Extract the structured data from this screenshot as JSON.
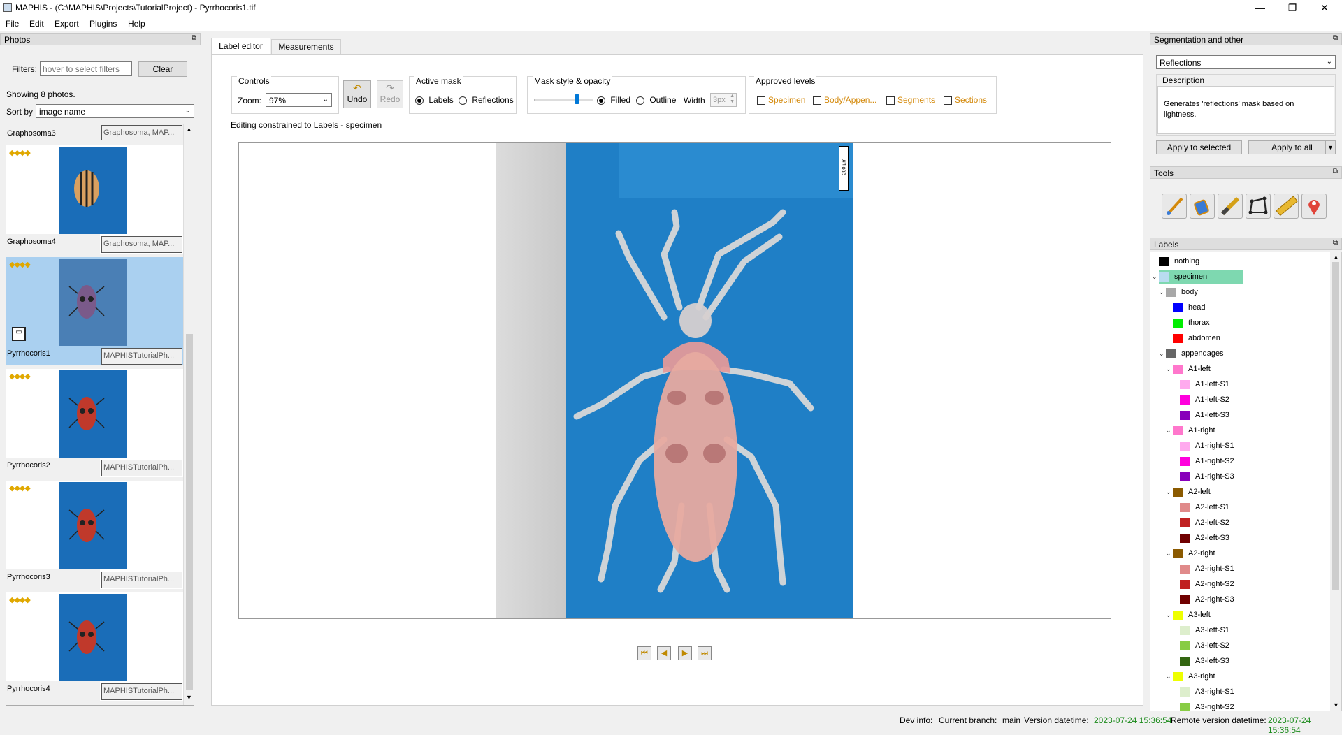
{
  "window": {
    "title": "MAPHIS - (C:\\MAPHIS\\Projects\\TutorialProject) - Pyrrhocoris1.tif",
    "minimize": "—",
    "maximize": "❐",
    "close": "✕"
  },
  "menu": [
    "File",
    "Edit",
    "Export",
    "Plugins",
    "Help"
  ],
  "photos_panel": {
    "title": "Photos",
    "filters_label": "Filters:",
    "filters_placeholder": "hover to select filters",
    "clear_label": "Clear",
    "showing": "Showing 8 photos.",
    "sort_label": "Sort by",
    "sort_value": "image name",
    "cards": [
      {
        "name": "Graphosoma3",
        "tag": "Graphosoma, MAP...",
        "stars": "◆◆◆◆",
        "kind": "grapho"
      },
      {
        "name": "Graphosoma4",
        "tag": "Graphosoma, MAP...",
        "stars": "◆◆◆◆",
        "kind": "grapho"
      },
      {
        "name": "Pyrrhocoris1",
        "tag": "MAPHISTutorialPh...",
        "stars": "◆◆◆◆",
        "kind": "pyrr"
      },
      {
        "name": "Pyrrhocoris2",
        "tag": "MAPHISTutorialPh...",
        "stars": "◆◆◆◆",
        "kind": "pyrr"
      },
      {
        "name": "Pyrrhocoris3",
        "tag": "MAPHISTutorialPh...",
        "stars": "◆◆◆◆",
        "kind": "pyrr"
      },
      {
        "name": "Pyrrhocoris4",
        "tag": "MAPHISTutorialPh...",
        "stars": "◆◆◆◆",
        "kind": "pyrr"
      }
    ]
  },
  "tabs": [
    "Label editor",
    "Measurements"
  ],
  "controls": {
    "title": "Controls",
    "zoom_label": "Zoom:",
    "zoom_value": "97%",
    "undo": "Undo",
    "redo": "Redo"
  },
  "active_mask": {
    "title": "Active mask",
    "options": [
      "Labels",
      "Reflections"
    ],
    "selected": "Labels"
  },
  "mask_style": {
    "title": "Mask style & opacity",
    "filled": "Filled",
    "outline": "Outline",
    "width_label": "Width",
    "width_value": "3px"
  },
  "approved": {
    "title": "Approved levels",
    "levels": [
      "Specimen",
      "Body/Appen...",
      "Segments",
      "Sections"
    ],
    "color": "#d4890a"
  },
  "editing_note": "Editing constrained to Labels - specimen",
  "scale_bar": "200 µm",
  "seg_panel": {
    "title": "Segmentation and other",
    "combo": "Reflections",
    "desc_title": "Description",
    "desc_text": "Generates 'reflections' mask based on lightness.",
    "apply_selected": "Apply to selected",
    "apply_all": "Apply to all"
  },
  "tools_panel": {
    "title": "Tools",
    "icons": [
      "brush-icon",
      "bucket-icon",
      "knife-icon",
      "polygon-icon",
      "ruler-icon",
      "pin-icon"
    ]
  },
  "labels_panel": {
    "title": "Labels",
    "items": [
      {
        "text": "nothing",
        "color": "#000000",
        "level": 0,
        "chev": ""
      },
      {
        "text": "specimen",
        "color": "#b9dcf0",
        "level": 0,
        "chev": "⌄",
        "selected": true
      },
      {
        "text": "body",
        "color": "#a8a8a8",
        "level": 1,
        "chev": "⌄"
      },
      {
        "text": "head",
        "color": "#0000ff",
        "level": 2,
        "chev": ""
      },
      {
        "text": "thorax",
        "color": "#00ee00",
        "level": 2,
        "chev": ""
      },
      {
        "text": "abdomen",
        "color": "#ff0000",
        "level": 2,
        "chev": ""
      },
      {
        "text": "appendages",
        "color": "#666666",
        "level": 1,
        "chev": "⌄"
      },
      {
        "text": "A1-left",
        "color": "#ff77cc",
        "level": 2,
        "chev": "⌄"
      },
      {
        "text": "A1-left-S1",
        "color": "#ffaaee",
        "level": 3,
        "chev": ""
      },
      {
        "text": "A1-left-S2",
        "color": "#ff00dd",
        "level": 3,
        "chev": ""
      },
      {
        "text": "A1-left-S3",
        "color": "#8800bb",
        "level": 3,
        "chev": ""
      },
      {
        "text": "A1-right",
        "color": "#ff77cc",
        "level": 2,
        "chev": "⌄"
      },
      {
        "text": "A1-right-S1",
        "color": "#ffaaee",
        "level": 3,
        "chev": ""
      },
      {
        "text": "A1-right-S2",
        "color": "#ff00dd",
        "level": 3,
        "chev": ""
      },
      {
        "text": "A1-right-S3",
        "color": "#8800bb",
        "level": 3,
        "chev": ""
      },
      {
        "text": "A2-left",
        "color": "#8b5a00",
        "level": 2,
        "chev": "⌄"
      },
      {
        "text": "A2-left-S1",
        "color": "#e08a8a",
        "level": 3,
        "chev": ""
      },
      {
        "text": "A2-left-S2",
        "color": "#c02020",
        "level": 3,
        "chev": ""
      },
      {
        "text": "A2-left-S3",
        "color": "#700000",
        "level": 3,
        "chev": ""
      },
      {
        "text": "A2-right",
        "color": "#8b5a00",
        "level": 2,
        "chev": "⌄"
      },
      {
        "text": "A2-right-S1",
        "color": "#e08a8a",
        "level": 3,
        "chev": ""
      },
      {
        "text": "A2-right-S2",
        "color": "#c02020",
        "level": 3,
        "chev": ""
      },
      {
        "text": "A2-right-S3",
        "color": "#700000",
        "level": 3,
        "chev": ""
      },
      {
        "text": "A3-left",
        "color": "#eeff00",
        "level": 2,
        "chev": "⌄"
      },
      {
        "text": "A3-left-S1",
        "color": "#ddeecc",
        "level": 3,
        "chev": ""
      },
      {
        "text": "A3-left-S2",
        "color": "#88cc44",
        "level": 3,
        "chev": ""
      },
      {
        "text": "A3-left-S3",
        "color": "#336611",
        "level": 3,
        "chev": ""
      },
      {
        "text": "A3-right",
        "color": "#eeff00",
        "level": 2,
        "chev": "⌄"
      },
      {
        "text": "A3-right-S1",
        "color": "#ddeecc",
        "level": 3,
        "chev": ""
      },
      {
        "text": "A3-right-S2",
        "color": "#88cc44",
        "level": 3,
        "chev": ""
      }
    ]
  },
  "status": {
    "dev_info": "Dev info:",
    "branch_label": "Current branch:",
    "branch": "main",
    "version_label": "Version datetime:",
    "version": "2023-07-24 15:36:54",
    "remote_label": "Remote version datetime:",
    "remote": "2023-07-24 15:36:54",
    "green": "#1a8a1a"
  }
}
